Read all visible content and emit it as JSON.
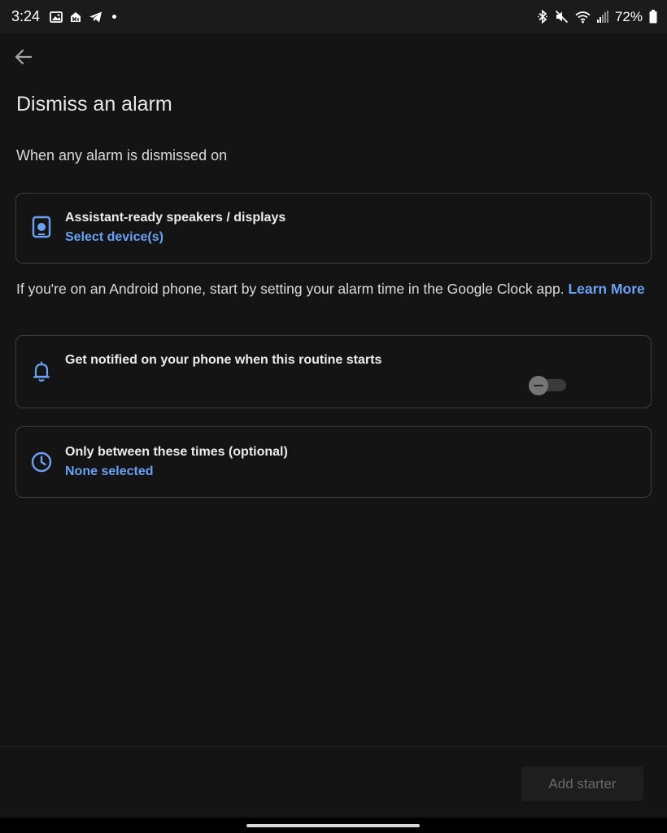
{
  "status_bar": {
    "time": "3:24",
    "left_icons": [
      "gallery-icon",
      "nfc-icon",
      "telegram-icon",
      "notification-dot"
    ],
    "right_icons": [
      "bluetooth-icon",
      "mute-icon",
      "wifi-icon",
      "signal-icon",
      "battery-icon"
    ],
    "battery": "72%"
  },
  "header": {
    "back_icon": "arrow-back-icon",
    "title": "Dismiss an alarm"
  },
  "trigger": {
    "label": "When any alarm is dismissed on"
  },
  "devices_card": {
    "icon": "speaker-icon",
    "title": "Assistant-ready speakers / displays",
    "link": "Select device(s)"
  },
  "info": {
    "text": "If you're on an Android phone, start by setting your alarm time in the Google Clock app. ",
    "link": "Learn More"
  },
  "notify_card": {
    "icon": "bell-icon",
    "title": "Get notified on your phone when this routine starts",
    "toggle_on": false
  },
  "times_card": {
    "icon": "clock-icon",
    "title": "Only between these times (optional)",
    "value": "None selected"
  },
  "footer": {
    "add_button": "Add starter"
  },
  "colors": {
    "background": "#141414",
    "accent": "#6ba1f5",
    "card_border": "#3d3d3d",
    "disabled_text": "#6a6a6a"
  }
}
